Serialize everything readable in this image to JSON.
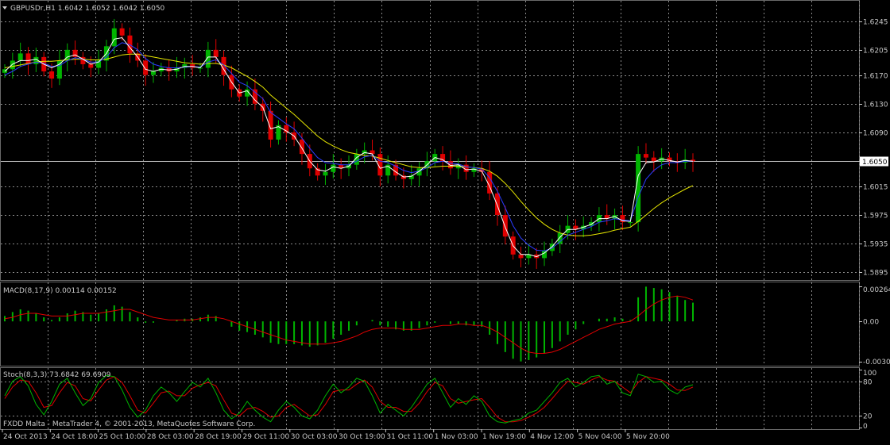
{
  "colors": {
    "background": "#000000",
    "grid": "#8a8a8a",
    "axis_text": "#c8c8c8",
    "bull": "#00b400",
    "bear": "#e00000",
    "ma_fast": "#ffffff",
    "ma_mid": "#2a3cff",
    "ma_slow": "#e6e600",
    "macd_hist": "#00b400",
    "macd_signal": "#e00000",
    "stoch_main": "#00b400",
    "stoch_signal": "#e00000",
    "price_tag_bg": "#ffffff",
    "price_tag_text": "#000000"
  },
  "header": {
    "symbol_line": "GBPUSDr,H1  1.6042 1.6052 1.6042 1.6050",
    "macd_line": "MACD(8,17,9) 0.00114 0.00152",
    "stoch_line": "Stoch(8,3,3) 73.6842 69.6909",
    "footer_line": "FXDD Malta - MetaTrader 4, © 2001-2013, MetaQuotes Software Corp.",
    "dropdown_icon": "triangle-down-icon"
  },
  "chart_data": [
    {
      "type": "candlestick",
      "symbol": "GBPUSDr",
      "timeframe": "H1",
      "ohlc_last": {
        "open": 1.6042,
        "high": 1.6052,
        "low": 1.6042,
        "close": 1.605
      },
      "current_price_label": "1.6050",
      "y_ticks": [
        "1.6245",
        "1.6205",
        "1.6170",
        "1.6130",
        "1.6090",
        "1.6050",
        "1.6015",
        "1.5975",
        "1.5935",
        "1.5895"
      ],
      "ylim": [
        1.589,
        1.627
      ],
      "x_ticks": [
        "24 Oct 2013",
        "24 Oct 18:00",
        "25 Oct 10:00",
        "28 Oct 03:00",
        "28 Oct 19:00",
        "29 Oct 11:00",
        "30 Oct 03:00",
        "30 Oct 19:00",
        "31 Oct 11:00",
        "1 Nov 03:00",
        "1 Nov 19:00",
        "4 Nov 12:00",
        "5 Nov 04:00",
        "5 Nov 20:00"
      ],
      "close_path": [
        1.6178,
        1.619,
        1.62,
        1.6185,
        1.6195,
        1.6175,
        1.6165,
        1.619,
        1.6205,
        1.6195,
        1.6185,
        1.618,
        1.619,
        1.621,
        1.6235,
        1.6225,
        1.62,
        1.619,
        1.617,
        1.6175,
        1.618,
        1.6175,
        1.618,
        1.6185,
        1.618,
        1.618,
        1.6205,
        1.6195,
        1.617,
        1.615,
        1.614,
        1.615,
        1.613,
        1.612,
        1.608,
        1.61,
        1.609,
        1.608,
        1.606,
        1.604,
        1.603,
        1.6035,
        1.6045,
        1.604,
        1.6045,
        1.606,
        1.6065,
        1.606,
        1.603,
        1.6045,
        1.603,
        1.6025,
        1.603,
        1.604,
        1.605,
        1.606,
        1.605,
        1.604,
        1.6045,
        1.6035,
        1.604,
        1.6035,
        1.6005,
        1.5975,
        1.5945,
        1.592,
        1.5915,
        1.592,
        1.5915,
        1.5925,
        1.5935,
        1.595,
        1.596,
        1.5955,
        1.596,
        1.5965,
        1.5975,
        1.597,
        1.5975,
        1.5965,
        1.5965,
        1.606,
        1.6055,
        1.605,
        1.6055,
        1.605,
        1.6048,
        1.6052,
        1.605
      ],
      "ma_fast_path": [
        1.6175,
        1.6185,
        1.619,
        1.619,
        1.6192,
        1.6185,
        1.618,
        1.6185,
        1.6195,
        1.6198,
        1.6192,
        1.6185,
        1.6188,
        1.62,
        1.622,
        1.6222,
        1.6208,
        1.6195,
        1.6178,
        1.6175,
        1.6178,
        1.6177,
        1.6178,
        1.6182,
        1.6182,
        1.618,
        1.6195,
        1.6195,
        1.6178,
        1.616,
        1.6145,
        1.6148,
        1.6135,
        1.6125,
        1.6095,
        1.6098,
        1.6092,
        1.6085,
        1.6068,
        1.605,
        1.6038,
        1.6036,
        1.6042,
        1.604,
        1.6043,
        1.6055,
        1.6062,
        1.606,
        1.604,
        1.6043,
        1.6035,
        1.6028,
        1.6029,
        1.6036,
        1.6045,
        1.6055,
        1.6052,
        1.6044,
        1.6045,
        1.6038,
        1.6039,
        1.6036,
        1.6015,
        1.5988,
        1.5958,
        1.5932,
        1.592,
        1.592,
        1.5917,
        1.5922,
        1.5931,
        1.5944,
        1.5955,
        1.5955,
        1.5958,
        1.5962,
        1.597,
        1.597,
        1.5973,
        1.5967,
        1.5966,
        1.603,
        1.6048,
        1.6049,
        1.6053,
        1.6051,
        1.6049,
        1.6051,
        1.605
      ],
      "ma_mid_path": [
        1.617,
        1.6175,
        1.6182,
        1.6185,
        1.6188,
        1.6186,
        1.6182,
        1.6183,
        1.619,
        1.6194,
        1.6192,
        1.6188,
        1.6188,
        1.6195,
        1.6208,
        1.6215,
        1.6212,
        1.6205,
        1.6193,
        1.6185,
        1.6182,
        1.618,
        1.618,
        1.6181,
        1.6182,
        1.6181,
        1.6188,
        1.6191,
        1.6184,
        1.6172,
        1.616,
        1.6155,
        1.6146,
        1.6137,
        1.6118,
        1.611,
        1.6102,
        1.6095,
        1.6082,
        1.6068,
        1.6055,
        1.6048,
        1.6047,
        1.6045,
        1.6045,
        1.605,
        1.6056,
        1.6058,
        1.605,
        1.6048,
        1.6043,
        1.6037,
        1.6034,
        1.6036,
        1.6041,
        1.6048,
        1.605,
        1.6047,
        1.6046,
        1.6042,
        1.6041,
        1.6039,
        1.6027,
        1.6008,
        1.5985,
        1.596,
        1.5943,
        1.5933,
        1.5926,
        1.5925,
        1.5929,
        1.5938,
        1.5947,
        1.5951,
        1.5955,
        1.5959,
        1.5965,
        1.5967,
        1.597,
        1.5968,
        1.5967,
        1.6,
        1.6025,
        1.6037,
        1.6045,
        1.6048,
        1.6048,
        1.605,
        1.605
      ],
      "ma_slow_path": [
        1.618,
        1.6182,
        1.6184,
        1.6186,
        1.6188,
        1.6189,
        1.6189,
        1.619,
        1.6191,
        1.6192,
        1.6192,
        1.6191,
        1.6191,
        1.6192,
        1.6195,
        1.6198,
        1.6199,
        1.6199,
        1.6197,
        1.6195,
        1.6193,
        1.6191,
        1.6189,
        1.6187,
        1.6186,
        1.6185,
        1.6186,
        1.6186,
        1.6184,
        1.618,
        1.6174,
        1.6168,
        1.6161,
        1.6153,
        1.6142,
        1.6133,
        1.6124,
        1.6115,
        1.6105,
        1.6095,
        1.6085,
        1.6077,
        1.6071,
        1.6066,
        1.6062,
        1.606,
        1.6058,
        1.6057,
        1.6054,
        1.6051,
        1.6048,
        1.6045,
        1.6042,
        1.6041,
        1.6041,
        1.6042,
        1.6043,
        1.6043,
        1.6043,
        1.6042,
        1.6041,
        1.604,
        1.6036,
        1.6029,
        1.6019,
        1.6007,
        1.5994,
        1.5982,
        1.5971,
        1.5962,
        1.5955,
        1.595,
        1.5947,
        1.5946,
        1.5946,
        1.5947,
        1.5949,
        1.5951,
        1.5954,
        1.5956,
        1.5958,
        1.5966,
        1.5975,
        1.5984,
        1.5992,
        1.5999,
        1.6005,
        1.6011,
        1.6016
      ]
    },
    {
      "type": "bar",
      "name": "MACD(8,17,9)",
      "values_last": {
        "macd": 0.00114,
        "signal": 0.00152
      },
      "y_ticks": [
        "0.00264",
        "0.00",
        "-0.00303"
      ],
      "ylim": [
        -0.0032,
        0.0028
      ],
      "histogram": [
        0.0004,
        0.0007,
        0.0009,
        0.0008,
        0.0006,
        0.0003,
        0.0001,
        0.0003,
        0.0006,
        0.0008,
        0.0007,
        0.0005,
        0.0006,
        0.0009,
        0.0012,
        0.0011,
        0.0007,
        0.0003,
        -0.0001,
        -0.0001,
        0.0,
        0.0,
        0.0001,
        0.0002,
        0.0002,
        0.0003,
        0.0005,
        0.0004,
        0.0,
        -0.0004,
        -0.0007,
        -0.0008,
        -0.001,
        -0.0012,
        -0.0016,
        -0.0017,
        -0.0017,
        -0.0017,
        -0.0018,
        -0.0019,
        -0.0018,
        -0.0016,
        -0.0013,
        -0.001,
        -0.0007,
        -0.0003,
        0.0,
        0.0001,
        -0.0003,
        -0.0004,
        -0.0006,
        -0.0007,
        -0.0007,
        -0.0005,
        -0.0003,
        -0.0001,
        0.0,
        -0.0002,
        -0.0002,
        -0.0003,
        -0.0003,
        -0.0004,
        -0.001,
        -0.0017,
        -0.0023,
        -0.0028,
        -0.003,
        -0.0029,
        -0.0027,
        -0.0024,
        -0.002,
        -0.0015,
        -0.001,
        -0.0006,
        -0.0002,
        0.0,
        0.0002,
        0.0002,
        0.0003,
        0.0002,
        0.0001,
        0.0018,
        0.0026,
        0.0025,
        0.0024,
        0.0022,
        0.0019,
        0.0016,
        0.0014
      ],
      "signal": [
        0.0002,
        0.0003,
        0.0005,
        0.0006,
        0.0006,
        0.0005,
        0.0004,
        0.0004,
        0.0004,
        0.0005,
        0.0006,
        0.0006,
        0.0006,
        0.0007,
        0.0008,
        0.0009,
        0.0009,
        0.0007,
        0.0005,
        0.0003,
        0.0002,
        0.0001,
        0.0001,
        0.0001,
        0.0001,
        0.0002,
        0.0003,
        0.0003,
        0.0002,
        0.0,
        -0.0002,
        -0.0004,
        -0.0006,
        -0.0008,
        -0.001,
        -0.0012,
        -0.0014,
        -0.0015,
        -0.0016,
        -0.0017,
        -0.0017,
        -0.0017,
        -0.0016,
        -0.0015,
        -0.0013,
        -0.0011,
        -0.0008,
        -0.0006,
        -0.0005,
        -0.0005,
        -0.0005,
        -0.0006,
        -0.0006,
        -0.0006,
        -0.0005,
        -0.0004,
        -0.0003,
        -0.0003,
        -0.0002,
        -0.0002,
        -0.0003,
        -0.0003,
        -0.0005,
        -0.0008,
        -0.0012,
        -0.0016,
        -0.002,
        -0.0023,
        -0.0024,
        -0.0024,
        -0.0023,
        -0.0021,
        -0.0018,
        -0.0015,
        -0.0012,
        -0.0009,
        -0.0006,
        -0.0004,
        -0.0002,
        -0.0001,
        0.0,
        0.0004,
        0.0009,
        0.0013,
        0.0016,
        0.0018,
        0.0019,
        0.0018,
        0.0016
      ]
    },
    {
      "type": "line",
      "name": "Stoch(8,3,3)",
      "values_last": {
        "main": 73.6842,
        "signal": 69.6909
      },
      "y_ticks": [
        "100",
        "80",
        "20",
        "0"
      ],
      "ylim": [
        0,
        100
      ],
      "main": [
        55,
        80,
        88,
        72,
        40,
        22,
        45,
        75,
        85,
        60,
        38,
        50,
        78,
        90,
        88,
        65,
        35,
        18,
        30,
        55,
        70,
        60,
        45,
        62,
        78,
        70,
        85,
        60,
        30,
        15,
        25,
        45,
        30,
        18,
        10,
        30,
        45,
        35,
        20,
        15,
        30,
        55,
        75,
        60,
        70,
        85,
        80,
        55,
        25,
        40,
        30,
        20,
        35,
        55,
        75,
        85,
        60,
        35,
        50,
        40,
        55,
        45,
        20,
        10,
        8,
        12,
        15,
        25,
        30,
        45,
        60,
        78,
        85,
        70,
        78,
        88,
        90,
        75,
        80,
        60,
        55,
        92,
        88,
        78,
        80,
        65,
        58,
        70,
        74
      ],
      "signal": [
        50,
        70,
        82,
        80,
        60,
        35,
        38,
        60,
        78,
        72,
        50,
        46,
        65,
        82,
        88,
        78,
        55,
        30,
        25,
        42,
        60,
        63,
        55,
        55,
        68,
        74,
        78,
        72,
        48,
        25,
        20,
        32,
        35,
        28,
        18,
        20,
        35,
        40,
        30,
        20,
        22,
        40,
        62,
        65,
        65,
        75,
        82,
        70,
        45,
        35,
        35,
        28,
        28,
        42,
        62,
        78,
        72,
        50,
        42,
        45,
        48,
        50,
        35,
        18,
        10,
        10,
        12,
        18,
        25,
        35,
        50,
        66,
        80,
        78,
        75,
        82,
        88,
        82,
        80,
        70,
        60,
        78,
        88,
        85,
        82,
        75,
        65,
        64,
        70
      ]
    }
  ]
}
